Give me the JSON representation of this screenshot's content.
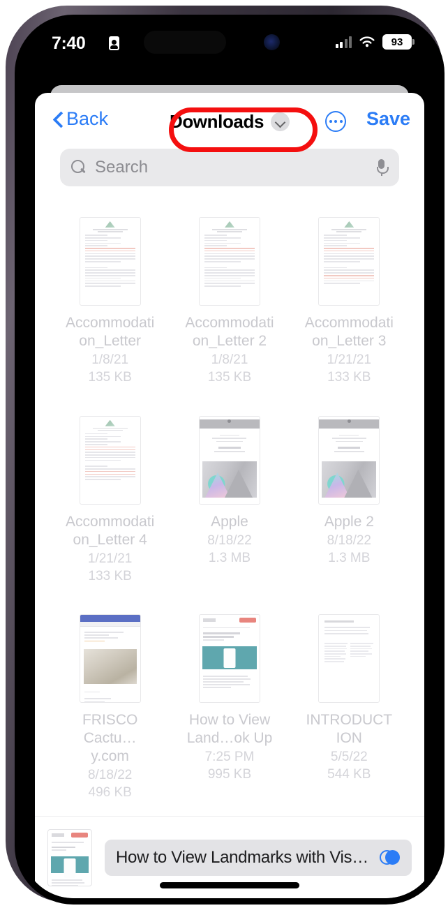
{
  "status_bar": {
    "time": "7:40",
    "lock_icon": "screen-record-icon",
    "signal_icon": "cellular-signal-icon",
    "wifi_icon": "wifi-icon",
    "battery_level": "93"
  },
  "nav_bar": {
    "back_label": "Back",
    "back_icon": "chevron-left-icon",
    "folder_title": "Downloads",
    "folder_chevron_icon": "chevron-down-icon",
    "more_icon": "ellipsis-circle-icon",
    "save_label": "Save",
    "highlight_color": "#f40f0f",
    "accent_color": "#2b7cf6"
  },
  "search": {
    "placeholder": "Search",
    "value": "",
    "search_icon": "search-icon",
    "mic_icon": "microphone-icon"
  },
  "files": [
    {
      "name": "Accommodation_Letter",
      "date": "1/8/21",
      "size": "135 KB",
      "thumb": "doc"
    },
    {
      "name": "Accommodation_Letter 2",
      "date": "1/8/21",
      "size": "135 KB",
      "thumb": "doc"
    },
    {
      "name": "Accommodation_Letter 3",
      "date": "1/21/21",
      "size": "133 KB",
      "thumb": "doc"
    },
    {
      "name": "Accommodation_Letter 4",
      "date": "1/21/21",
      "size": "133 KB",
      "thumb": "doc"
    },
    {
      "name": "Apple",
      "date": "8/18/22",
      "size": "1.3 MB",
      "thumb": "apple"
    },
    {
      "name": "Apple 2",
      "date": "8/18/22",
      "size": "1.3 MB",
      "thumb": "apple"
    },
    {
      "name": "FRISCO Cactu…y.com",
      "date": "8/18/22",
      "size": "496 KB",
      "thumb": "browser"
    },
    {
      "name": "How to View Land…ok Up",
      "date": "7:25 PM",
      "size": "995 KB",
      "thumb": "article"
    },
    {
      "name": "INTRODUCTION",
      "date": "5/5/22",
      "size": "544 KB",
      "thumb": "plaindoc"
    }
  ],
  "bottom_bar": {
    "filename": "How to View Landmarks with Vis…",
    "markup_icon": "markup-circles-icon",
    "thumbnail": "article-thumbnail"
  },
  "home_indicator": "home-indicator"
}
